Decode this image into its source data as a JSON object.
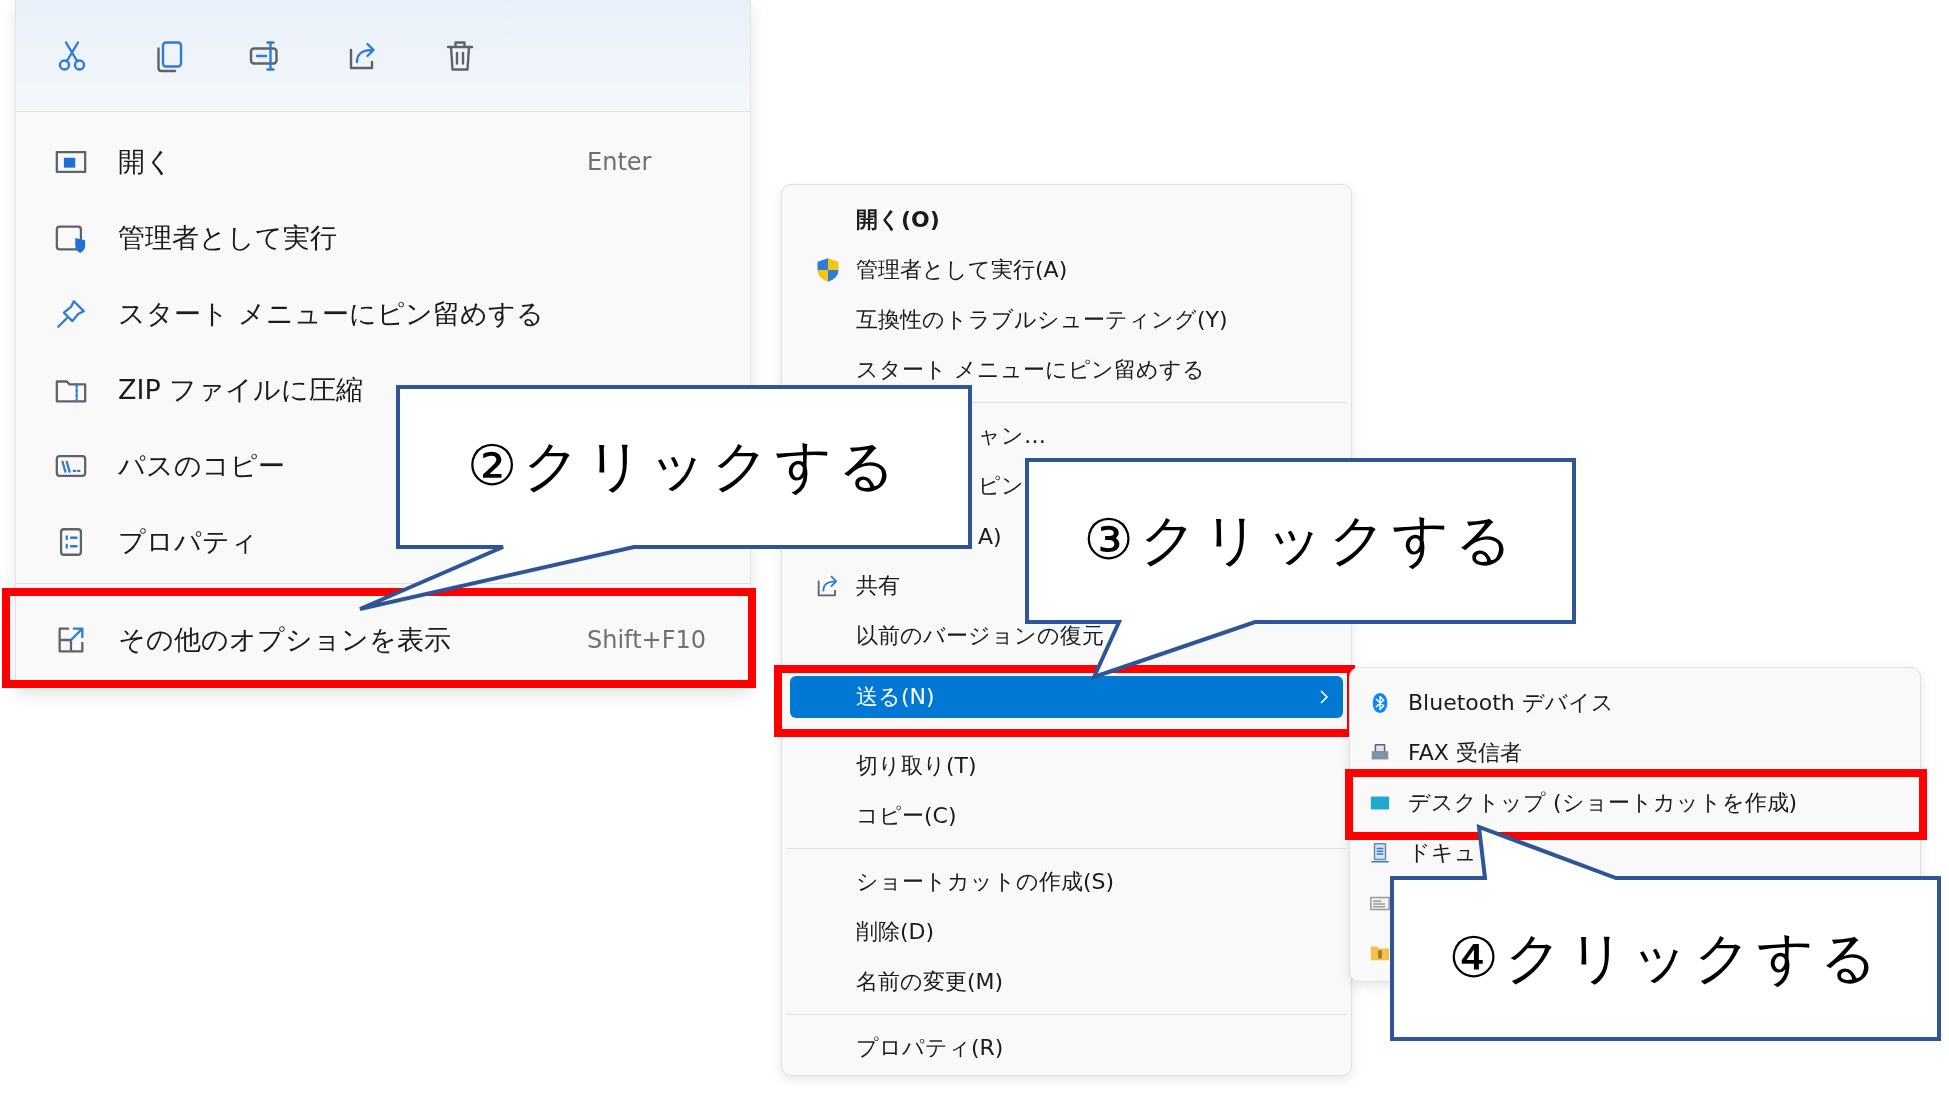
{
  "context_menu": {
    "toolbar": [
      {
        "kind": "cut"
      },
      {
        "kind": "copy"
      },
      {
        "kind": "rename"
      },
      {
        "kind": "share"
      },
      {
        "kind": "delete"
      }
    ],
    "items": [
      {
        "kind": "open",
        "label": "開く",
        "shortcut": "Enter",
        "framed": false
      },
      {
        "kind": "admin",
        "label": "管理者として実行",
        "framed": false
      },
      {
        "kind": "pin",
        "label": "スタート メニューにピン留めする",
        "framed": false
      },
      {
        "kind": "zip",
        "label": "ZIP ファイルに圧縮",
        "framed": false
      },
      {
        "kind": "path",
        "label": "パスのコピー",
        "framed": false
      },
      {
        "kind": "properties",
        "label": "プロパティ",
        "framed": false
      },
      {
        "kind": "separator"
      },
      {
        "kind": "more",
        "label": "その他のオプションを表示",
        "shortcut": "Shift+F10",
        "framed": true
      }
    ]
  },
  "classic_menu": {
    "items": [
      {
        "kind": "plain",
        "label": "開く(O)",
        "bold": true,
        "selected": false,
        "framed": false
      },
      {
        "kind": "uac",
        "label": "管理者として実行(A)",
        "bold": false,
        "selected": false,
        "framed": false
      },
      {
        "kind": "plain",
        "label": "互換性のトラブルシューティング(Y)",
        "bold": false,
        "selected": false,
        "framed": false
      },
      {
        "kind": "plain",
        "label": "スタート メニューにピン留めする",
        "bold": false,
        "selected": false,
        "framed": false
      },
      {
        "kind": "separator"
      },
      {
        "kind": "partial",
        "label": "ャン…",
        "bold": false,
        "selected": false,
        "framed": false
      },
      {
        "kind": "partial",
        "label": "ピン",
        "bold": false,
        "selected": false,
        "framed": false
      },
      {
        "kind": "partial",
        "label": "A)",
        "bold": false,
        "selected": false,
        "framed": false
      },
      {
        "kind": "share",
        "label": "共有",
        "bold": false,
        "selected": false,
        "framed": false
      },
      {
        "kind": "plain",
        "label": "以前のバージョンの復元",
        "bold": false,
        "selected": false,
        "framed": false
      },
      {
        "kind": "submenu",
        "label": "送る(N)",
        "bold": false,
        "selected": true,
        "framed": true
      },
      {
        "kind": "plain",
        "label": "切り取り(T)",
        "bold": false,
        "selected": false,
        "framed": false
      },
      {
        "kind": "plain",
        "label": "コピー(C)",
        "bold": false,
        "selected": false,
        "framed": false
      },
      {
        "kind": "separator"
      },
      {
        "kind": "plain",
        "label": "ショートカットの作成(S)",
        "bold": false,
        "selected": false,
        "framed": false
      },
      {
        "kind": "plain",
        "label": "削除(D)",
        "bold": false,
        "selected": false,
        "framed": false
      },
      {
        "kind": "plain",
        "label": "名前の変更(M)",
        "bold": false,
        "selected": false,
        "framed": false
      },
      {
        "kind": "separator"
      },
      {
        "kind": "plain",
        "label": "プロパティ(R)",
        "bold": false,
        "selected": false,
        "framed": false
      }
    ]
  },
  "send_to_menu": {
    "items": [
      {
        "kind": "bluetooth",
        "label": "Bluetooth デバイス",
        "framed": false
      },
      {
        "kind": "fax",
        "label": "FAX 受信者",
        "framed": false
      },
      {
        "kind": "desktop",
        "label": "デスクトップ (ショートカットを作成)",
        "framed": true
      },
      {
        "kind": "document",
        "label": "ドキュ",
        "framed": false
      },
      {
        "kind": "mail",
        "framed": false
      },
      {
        "kind": "zipfolder",
        "framed": false
      }
    ]
  },
  "callouts": [
    {
      "text": "②クリックする"
    },
    {
      "text": "③クリックする"
    },
    {
      "text": "④クリックする"
    }
  ]
}
